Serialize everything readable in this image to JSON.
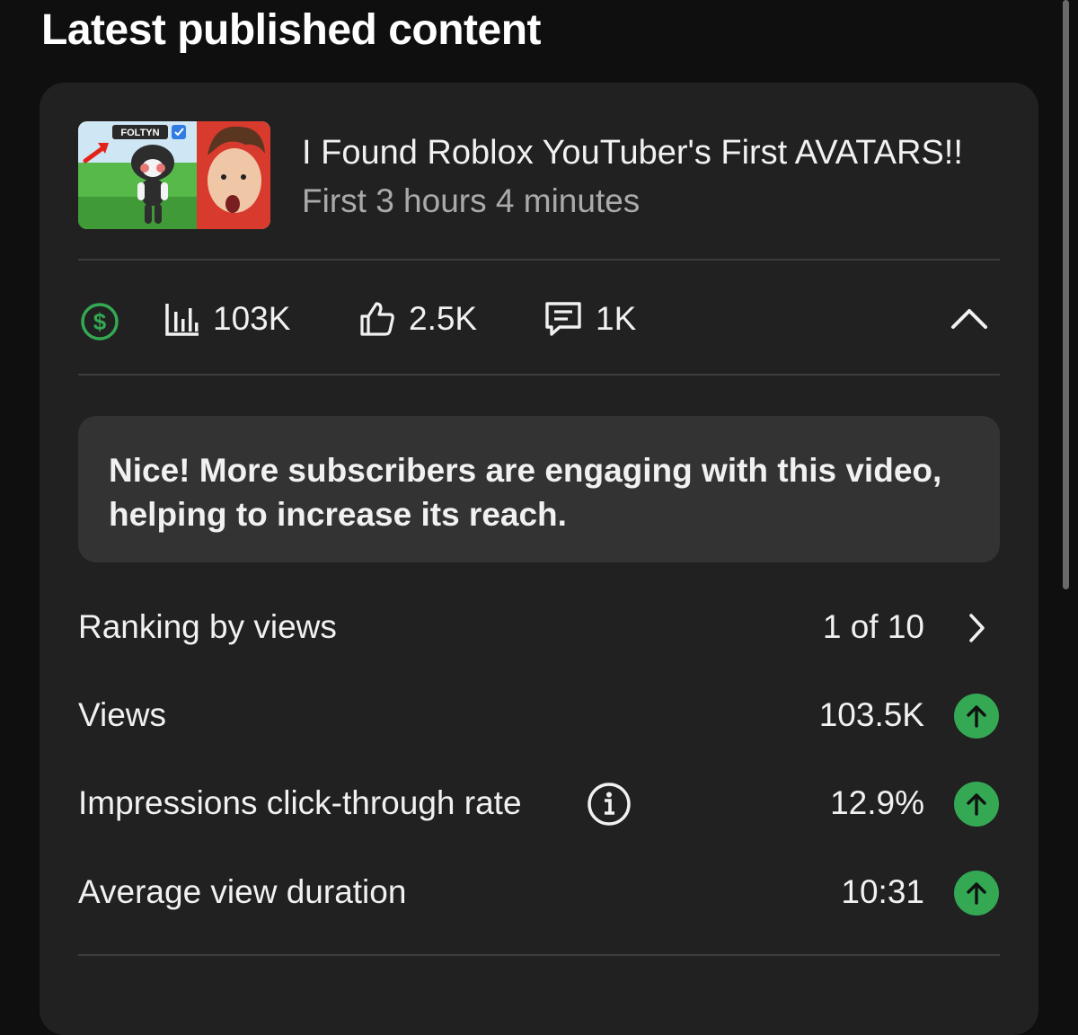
{
  "section": {
    "title": "Latest published content"
  },
  "video": {
    "title": "I Found Roblox YouTuber's First AVATARS!!",
    "subtitle": "First 3 hours 4 minutes",
    "thumbnail_text": "FOLTYN"
  },
  "stats": {
    "monetization_icon": "dollar-circle-icon",
    "views": "103K",
    "likes": "2.5K",
    "comments": "1K",
    "collapse_icon": "chevron-up-icon"
  },
  "insight": {
    "text": "Nice! More subscribers are engaging with this video, helping to increase its reach."
  },
  "metrics": [
    {
      "label": "Ranking by views",
      "value": "1 of 10",
      "trailing": "chevron-right-icon"
    },
    {
      "label": "Views",
      "value": "103.5K",
      "trailing": "arrow-up-icon"
    },
    {
      "label": "Impressions click-through rate",
      "value": "12.9%",
      "trailing": "arrow-up-icon",
      "has_info": true
    },
    {
      "label": "Average view duration",
      "value": "10:31",
      "trailing": "arrow-up-icon"
    }
  ],
  "colors": {
    "background": "#0f0f0f",
    "card": "#212121",
    "insight_box": "#333333",
    "accent_green": "#34a853",
    "muted_text": "#aaaaaa"
  }
}
